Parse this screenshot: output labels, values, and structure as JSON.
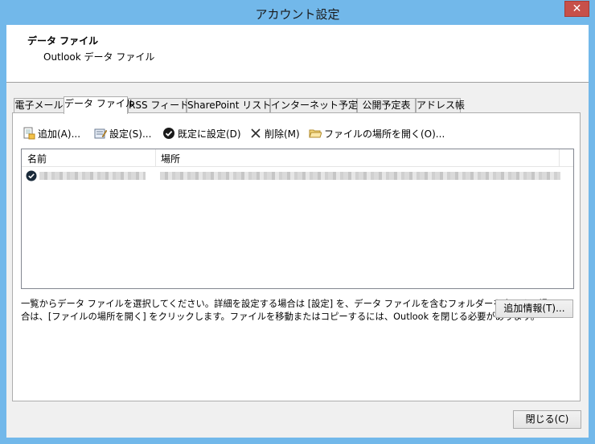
{
  "window": {
    "title": "アカウント設定",
    "close_glyph": "✕"
  },
  "header": {
    "title": "データ ファイル",
    "subtitle": "Outlook データ ファイル"
  },
  "tabs": [
    {
      "label": "電子メール",
      "active": false
    },
    {
      "label": "データ ファイル",
      "active": true
    },
    {
      "label": "RSS フィード",
      "active": false
    },
    {
      "label": "SharePoint リスト",
      "active": false
    },
    {
      "label": "インターネット予定表",
      "active": false
    },
    {
      "label": "公開予定表",
      "active": false
    },
    {
      "label": "アドレス帳",
      "active": false
    }
  ],
  "toolbar": {
    "add": "追加(A)...",
    "settings": "設定(S)...",
    "set_default": "既定に設定(D)",
    "delete": "削除(M)",
    "open_location": "ファイルの場所を開く(O)..."
  },
  "list": {
    "col_name": "名前",
    "col_location": "場所"
  },
  "description": {
    "line1": "一覧からデータ ファイルを選択してください。詳細を設定する場合は [設定] を、データ ファイルを含むフォルダーを表示する場",
    "line2": "合は、[ファイルの場所を開く] をクリックします。ファイルを移動またはコピーするには、Outlook を閉じる必要があります。"
  },
  "buttons": {
    "more_info": "追加情報(T)...",
    "close": "閉じる(C)"
  }
}
